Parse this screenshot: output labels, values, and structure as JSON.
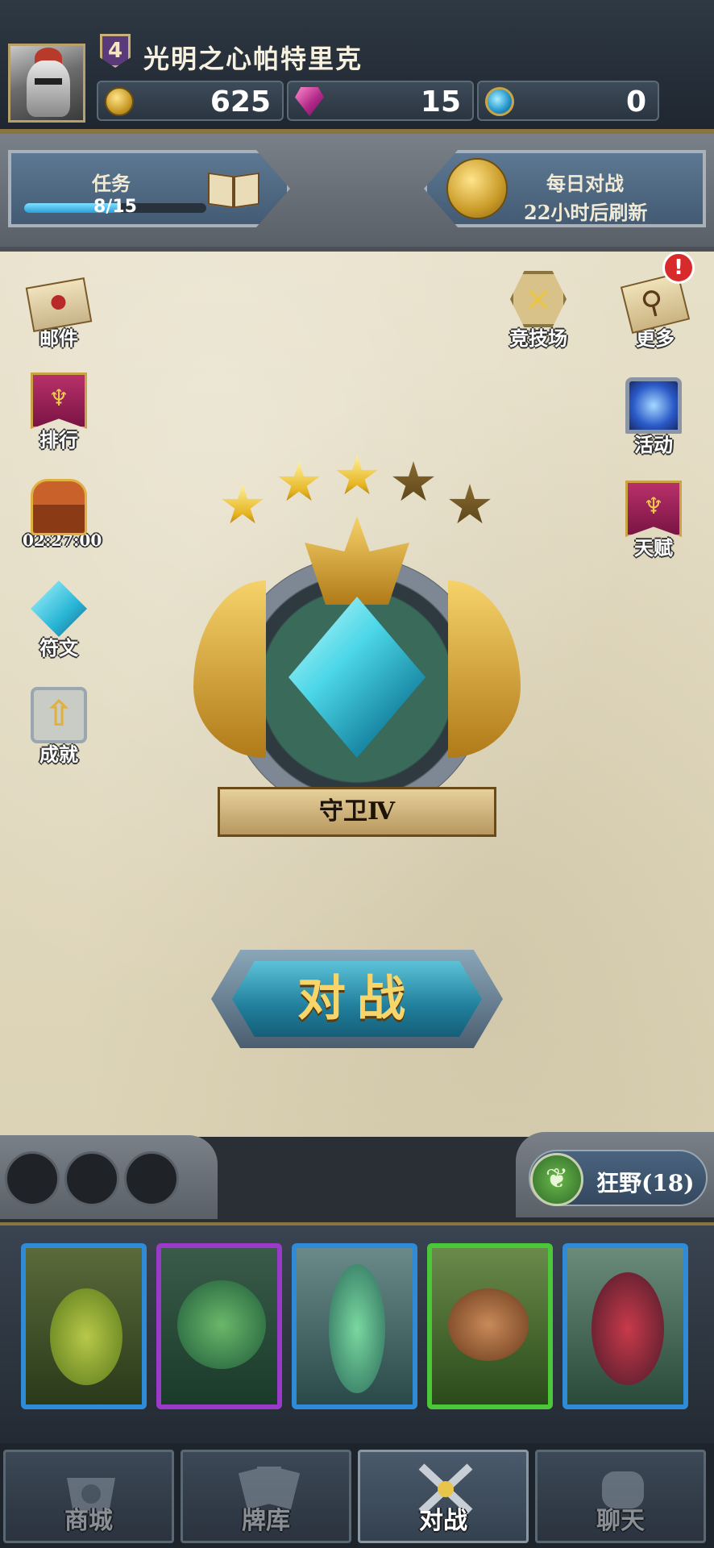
{
  "player": {
    "level": "4",
    "name": "光明之心帕特里克"
  },
  "resources": {
    "gold": "625",
    "gems": "15",
    "orbs": "0"
  },
  "quest": {
    "title": "任务",
    "progress": "8/15",
    "fraction": 0.533
  },
  "daily": {
    "title": "每日对战",
    "subtitle": "22小时后刷新"
  },
  "left_menu": [
    {
      "id": "mail",
      "label": "邮件",
      "icon": "mail-icon"
    },
    {
      "id": "rank",
      "label": "排行",
      "icon": "banner-icon"
    },
    {
      "id": "chest",
      "label": "02:27:00",
      "icon": "treasure-chest-icon"
    },
    {
      "id": "rune",
      "label": "符文",
      "icon": "rune-crystal-icon"
    },
    {
      "id": "achievement",
      "label": "成就",
      "icon": "achievement-icon"
    }
  ],
  "right_menu": [
    {
      "id": "arena",
      "label": "竞技场",
      "icon": "crossed-swords-icon"
    },
    {
      "id": "more",
      "label": "更多",
      "icon": "magnifier-scroll-icon",
      "alert": "!"
    },
    {
      "id": "events",
      "label": "活动",
      "icon": "portal-icon"
    },
    {
      "id": "talent",
      "label": "天赋",
      "icon": "banner-icon"
    }
  ],
  "rank": {
    "stars_earned": 3,
    "stars_total": 5,
    "title": "守卫Ⅳ"
  },
  "battle_button": "对战",
  "deck": {
    "label": "狂野(18)",
    "icon": "leaf-icon",
    "empty_slots": 3
  },
  "cards": [
    {
      "frame": "blue",
      "subject": "serpent"
    },
    {
      "frame": "purple",
      "subject": "crocodile"
    },
    {
      "frame": "blue",
      "subject": "fairy"
    },
    {
      "frame": "green",
      "subject": "squirrel"
    },
    {
      "frame": "blue",
      "subject": "carnivorous-plant"
    }
  ],
  "nav": [
    {
      "label": "商城",
      "icon": "shop-icon",
      "active": false
    },
    {
      "label": "牌库",
      "icon": "card-deck-icon",
      "active": false
    },
    {
      "label": "对战",
      "icon": "battle-swords-icon",
      "active": true
    },
    {
      "label": "聊天",
      "icon": "chat-fist-icon",
      "active": false
    }
  ],
  "colors": {
    "gold": "#f7d56a",
    "frame_blue": "#2f8ad8",
    "frame_purple": "#9a3ac8",
    "frame_green": "#4ac83a",
    "alert": "#d82a2a"
  }
}
